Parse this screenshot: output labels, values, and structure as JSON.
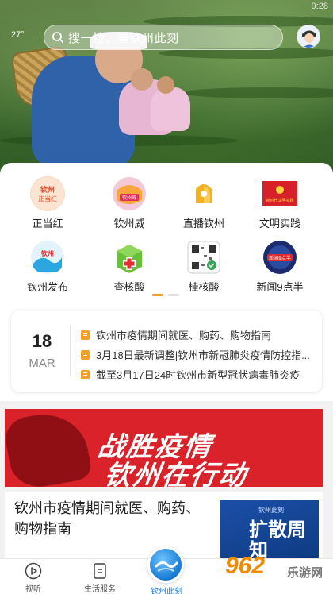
{
  "status": {
    "weather": "27°",
    "corner_watermark": "9:28"
  },
  "search": {
    "placeholder": "搜一搜，看钦州此刻"
  },
  "grid": [
    {
      "label": "正当红",
      "icon": "zhengdanghong-icon",
      "badge": "钦州 正当红",
      "color": "#f07a2a"
    },
    {
      "label": "钦州威",
      "icon": "qinzhouwei-icon",
      "badge": "钦州威",
      "color": "#e04a6a"
    },
    {
      "label": "直播钦州",
      "icon": "live-icon",
      "badge": "",
      "color": "#f2b21f"
    },
    {
      "label": "文明实践",
      "icon": "civilization-icon",
      "badge": "新时代文明实践",
      "color": "#d8202a"
    },
    {
      "label": "钦州发布",
      "icon": "publish-icon",
      "badge": "钦州发布",
      "color": "#2aa7e0"
    },
    {
      "label": "查核酸",
      "icon": "medical-kit-icon",
      "badge": "",
      "color": "#6abf3a"
    },
    {
      "label": "桂核酸",
      "icon": "qr-code-icon",
      "badge": "",
      "color": "#3aa35a"
    },
    {
      "label": "新闻9点半",
      "icon": "news-icon",
      "badge": "新闻9点半",
      "color": "#1c2b6e"
    }
  ],
  "ticker": {
    "day": "18",
    "month": "MAR",
    "items": [
      "钦州市疫情期间就医、购药、购物指南",
      "3月18日最新调整|钦州市新冠肺炎疫情防控指...",
      "截至3月17日24时钦州市新型冠状病毒肺炎疫"
    ]
  },
  "banner": {
    "line1": "战胜疫情",
    "line2": "钦州在行动"
  },
  "article": {
    "title": "钦州市疫情期间就医、购药、购物指南",
    "thumb_text": "扩散周知",
    "thumb_small": "钦州此刻"
  },
  "nav": {
    "items": [
      {
        "label": "视听",
        "icon": "play-icon"
      },
      {
        "label": "生活服务",
        "icon": "service-icon"
      },
      {
        "label": "钦州此刻",
        "icon": "globe-icon"
      }
    ]
  },
  "watermark": {
    "num": "962",
    "cn": "乐游网"
  }
}
